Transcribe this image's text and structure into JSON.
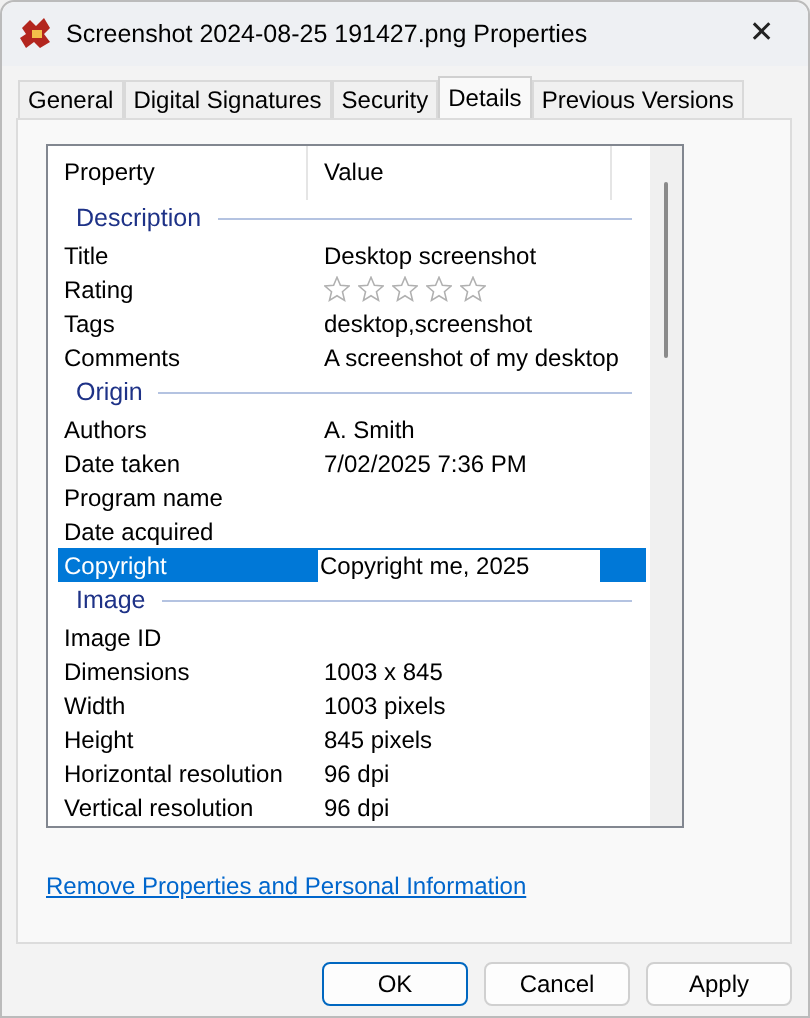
{
  "window": {
    "title": "Screenshot 2024-08-25 191427.png Properties",
    "close": "✕"
  },
  "tabs": [
    {
      "label": "General",
      "selected": false
    },
    {
      "label": "Digital Signatures",
      "selected": false
    },
    {
      "label": "Security",
      "selected": false
    },
    {
      "label": "Details",
      "selected": true
    },
    {
      "label": "Previous Versions",
      "selected": false
    }
  ],
  "table": {
    "columns": [
      "Property",
      "Value"
    ],
    "groups": [
      {
        "heading": "Description",
        "rows": [
          {
            "property": "Title",
            "value": "Desktop screenshot",
            "kind": "text",
            "selected": false
          },
          {
            "property": "Rating",
            "kind": "stars",
            "stars": 0,
            "selected": false
          },
          {
            "property": "Tags",
            "value": "desktop,screenshot",
            "kind": "text",
            "selected": false
          },
          {
            "property": "Comments",
            "value": "A screenshot of my desktop",
            "kind": "text",
            "selected": false
          }
        ]
      },
      {
        "heading": "Origin",
        "rows": [
          {
            "property": "Authors",
            "value": "A. Smith",
            "kind": "text",
            "selected": false
          },
          {
            "property": "Date taken",
            "value": "7/02/2025 7:36 PM",
            "kind": "text",
            "selected": false
          },
          {
            "property": "Program name",
            "kind": "text",
            "selected": false
          },
          {
            "property": "Date acquired",
            "kind": "text",
            "selected": false
          },
          {
            "property": "Copyright",
            "value": "Copyright me, 2025",
            "kind": "field",
            "selected": true
          }
        ]
      },
      {
        "heading": "Image",
        "rows": [
          {
            "property": "Image ID",
            "kind": "text",
            "selected": false
          },
          {
            "property": "Dimensions",
            "value": "1003 x 845",
            "kind": "text",
            "selected": false
          },
          {
            "property": "Width",
            "value": "1003 pixels",
            "kind": "text",
            "selected": false
          },
          {
            "property": "Height",
            "value": "845 pixels",
            "kind": "text",
            "selected": false
          },
          {
            "property": "Horizontal resolution",
            "value": "96 dpi",
            "kind": "text",
            "selected": false
          },
          {
            "property": "Vertical resolution",
            "value": "96 dpi",
            "kind": "text",
            "selected": false
          }
        ]
      }
    ]
  },
  "link": "Remove Properties and Personal Information",
  "buttons": [
    {
      "label": "OK",
      "default": true
    },
    {
      "label": "Cancel",
      "default": false
    },
    {
      "label": "Apply",
      "default": false
    }
  ]
}
